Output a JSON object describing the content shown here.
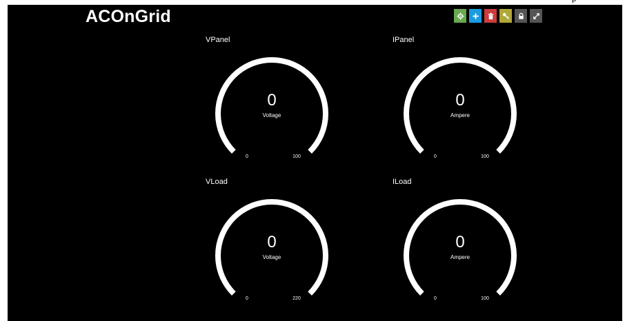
{
  "header": {
    "title": "ACOnGrid",
    "top_ellipsis": "ρ"
  },
  "toolbar": {
    "buttons": [
      {
        "name": "settings",
        "icon": "gear-icon",
        "color": "#6aa84f"
      },
      {
        "name": "add",
        "icon": "plus-icon",
        "color": "#1a9be0"
      },
      {
        "name": "delete",
        "icon": "trash-icon",
        "color": "#cc3d3d"
      },
      {
        "name": "key",
        "icon": "key-icon",
        "color": "#b0a838"
      },
      {
        "name": "lock",
        "icon": "lock-icon",
        "color": "#555555"
      },
      {
        "name": "fullscreen",
        "icon": "expand-icon",
        "color": "#555555"
      }
    ]
  },
  "gauges": [
    {
      "title": "VPanel",
      "value": "0",
      "unit": "Voltage",
      "min": "0",
      "max": "100",
      "level": 0
    },
    {
      "title": "IPanel",
      "value": "0",
      "unit": "Ampere",
      "min": "0",
      "max": "100",
      "level": 0
    },
    {
      "title": "VLoad",
      "value": "0",
      "unit": "Voltage",
      "min": "0",
      "max": "220",
      "level": 0
    },
    {
      "title": "ILoad",
      "value": "0",
      "unit": "Ampere",
      "min": "0",
      "max": "100",
      "level": 0
    }
  ],
  "colors": {
    "background": "#000000",
    "gauge_track": "#ffffff",
    "text": "#ffffff"
  }
}
